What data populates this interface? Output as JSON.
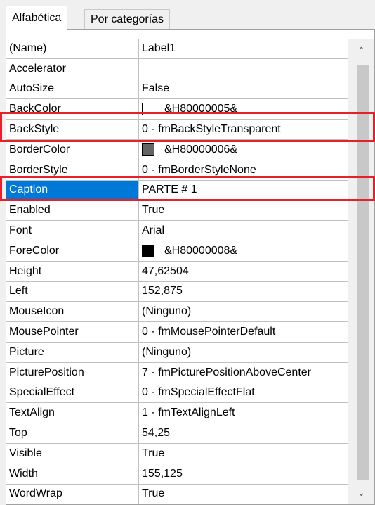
{
  "tabs": [
    {
      "label": "Alfabética",
      "active": true
    },
    {
      "label": "Por categorías",
      "active": false
    }
  ],
  "properties": [
    {
      "name": "(Name)",
      "value": "Label1"
    },
    {
      "name": "Accelerator",
      "value": ""
    },
    {
      "name": "AutoSize",
      "value": "False"
    },
    {
      "name": "BackColor",
      "value": "&H80000005&",
      "swatch": "#ffffff"
    },
    {
      "name": "BackStyle",
      "value": "0 - fmBackStyleTransparent"
    },
    {
      "name": "BorderColor",
      "value": "&H80000006&",
      "swatch": "#646464"
    },
    {
      "name": "BorderStyle",
      "value": "0 - fmBorderStyleNone"
    },
    {
      "name": "Caption",
      "value": "PARTE # 1",
      "selected": true
    },
    {
      "name": "Enabled",
      "value": "True"
    },
    {
      "name": "Font",
      "value": "Arial"
    },
    {
      "name": "ForeColor",
      "value": "&H80000008&",
      "swatch": "#000000"
    },
    {
      "name": "Height",
      "value": "47,62504"
    },
    {
      "name": "Left",
      "value": "152,875"
    },
    {
      "name": "MouseIcon",
      "value": "(Ninguno)"
    },
    {
      "name": "MousePointer",
      "value": "0 - fmMousePointerDefault"
    },
    {
      "name": "Picture",
      "value": "(Ninguno)"
    },
    {
      "name": "PicturePosition",
      "value": "7 - fmPicturePositionAboveCenter"
    },
    {
      "name": "SpecialEffect",
      "value": "0 - fmSpecialEffectFlat"
    },
    {
      "name": "TextAlign",
      "value": "1 - fmTextAlignLeft"
    },
    {
      "name": "Top",
      "value": "54,25"
    },
    {
      "name": "Visible",
      "value": "True"
    },
    {
      "name": "Width",
      "value": "155,125"
    },
    {
      "name": "WordWrap",
      "value": "True"
    }
  ],
  "colors": {
    "selection": "#0078d7",
    "highlight_border": "#e8202a"
  },
  "icons": {
    "scroll_up": "chevron-up-icon",
    "scroll_down": "chevron-down-icon"
  }
}
